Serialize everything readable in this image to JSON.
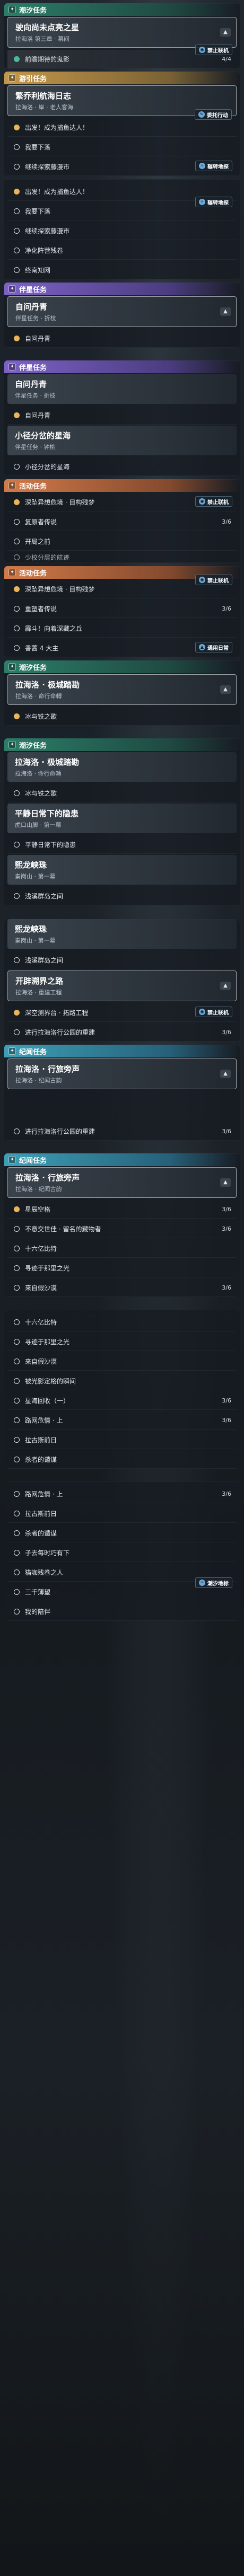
{
  "categories": {
    "daily": "潮汐任务",
    "world": "游引任务",
    "companion": "伴星任务",
    "activity": "活动任务",
    "harbor": "纪闻任务",
    "story": "纪闻任务"
  },
  "tags": {
    "nofriend": "禁止联机",
    "entrust": "委托行动",
    "explore": "辗转地探",
    "explore2": "潮汐地探",
    "common": "通用日常",
    "tide": "潮汐地标"
  },
  "b1": {
    "card_title": "驶向尚未点亮之星",
    "card_sub": "拉海洛 第三章 · 幕间",
    "obj1": "前瞻期待的鬼影",
    "progress": "4/4"
  },
  "b2": {
    "card_title": "繁乔利航海日志",
    "card_sub": "拉海洛 · 岸 · 老人客海",
    "objs": [
      "出发！成为捕鱼达人！",
      "我要下落",
      "继续探索藤漫市"
    ]
  },
  "b3": {
    "objs": [
      "出发！成为捕鱼达人！",
      "我要下落",
      "继续探索藤漫市",
      "净化阵营残卷",
      "终南知网"
    ]
  },
  "b4": {
    "card_title": "自问丹青",
    "card_sub": "伴星任务 · 折枝",
    "obj1": "自问丹青"
  },
  "b5": {
    "card_title": "自问丹青",
    "card_sub": "伴星任务 · 折枝",
    "obj1": "自问丹青",
    "card2_title": "小径分岔的星海",
    "card2_sub": "伴星任务 · 钟桃",
    "obj2": "小径分岔的星海"
  },
  "b6": {
    "objs": [
      "深坠异想危境 · 目构残梦",
      "复原者传说",
      "开局之前"
    ],
    "cnt": "3/6",
    "tail": "少校分层的航迹"
  },
  "b7": {
    "objs": [
      "深坠异想危境 · 目构残梦",
      "重塑者传说",
      "霹斗！向着深藏之丘",
      "香蔷 4 大主"
    ],
    "cnt": "3/6"
  },
  "b8": {
    "card_title": "拉海洛 · 极城踏勘",
    "card_sub": "拉海洛 · 命行命轉",
    "obj1": "冰与铁之歌"
  },
  "b9": {
    "card_title": "拉海洛 · 极城踏勘",
    "card_sub": "拉海洛 · 命行命轉",
    "obj1": "冰与铁之歌",
    "card2_title": "平静日常下的隐患",
    "card2_sub": "虎口山脚 · 第一幕",
    "obj2": "平静日常下的隐患",
    "card3_title": "熙龙峡珠",
    "card3_sub": "秦岗山 · 第一幕",
    "obj3": "浅溪群岛之间"
  },
  "b10": {
    "card_title": "熙龙峡珠",
    "card_sub": "秦岗山 · 第一幕",
    "obj1": "浅溪群岛之间",
    "card2_title": "开辟溯界之路",
    "card2_sub": "拉海洛 · 重建工程",
    "obj2a": "深空测界台 · 拓路工程",
    "obj2b": "进行拉海洛行公园的重建",
    "cnt": "3/6"
  },
  "b11": {
    "card_title": "拉海洛 · 行旅旁声",
    "card_sub": "拉海洛 · 纪闻古韵",
    "obj1": "进行拉海洛行公园的重建",
    "cnt": "3/6"
  },
  "b12": {
    "card_title": "拉海洛 · 行旅旁声",
    "card_sub": "拉海洛 · 纪闻古韵",
    "objs": [
      "星辰空格",
      "不意交世佳 · 留名的藏物者",
      "十六亿比特",
      "寻迹于那里之光",
      "来自假沙漠"
    ],
    "cnts": [
      "3/6",
      "3/6",
      "",
      "",
      "3/6"
    ]
  },
  "b13": {
    "objs": [
      "十六亿比特",
      "寻迹于那里之光",
      "来自假沙漠",
      "被光影定格的瞬间",
      "星海回收（一）",
      "路网危情 · 上",
      "拉古斯前日",
      "杀者的谴谋"
    ],
    "cnts": [
      "",
      "",
      "",
      "",
      "3/6",
      "3/6",
      "",
      ""
    ]
  },
  "b14": {
    "objs": [
      "路网危情 · 上",
      "拉古斯前日",
      "杀者的谴谋",
      "子去每时巧有下",
      "猫咖残卷之人",
      "三千薄望",
      "我的陪伴"
    ],
    "cnts": [
      "3/6",
      "",
      "",
      "",
      "",
      "",
      ""
    ]
  }
}
